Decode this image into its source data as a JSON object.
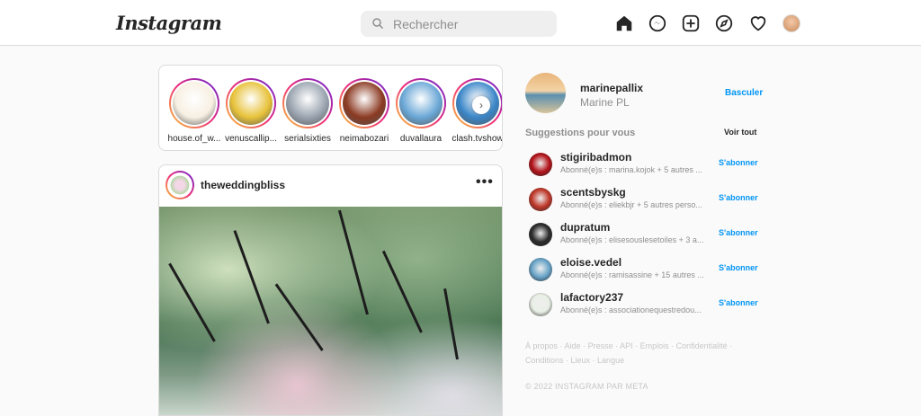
{
  "header": {
    "logo": "Instagram",
    "search_placeholder": "Rechercher",
    "nav_icons": [
      "home-icon",
      "messenger-icon",
      "new-post-icon",
      "explore-icon",
      "activity-icon",
      "profile-avatar"
    ]
  },
  "stories": [
    {
      "name": "house.of_w...",
      "color": "#f7efe2"
    },
    {
      "name": "venuscallip...",
      "color": "#e7c23a"
    },
    {
      "name": "serialsixties",
      "color": "#9aa4b0"
    },
    {
      "name": "neimabozari",
      "color": "#8b3a22"
    },
    {
      "name": "duvallaura",
      "color": "#6aa7d6"
    },
    {
      "name": "clash.tvshow",
      "color": "#3a86c8"
    }
  ],
  "post": {
    "username": "theweddingbliss",
    "more": "•••"
  },
  "profile": {
    "username": "marinepallix",
    "fullname": "Marine PL",
    "switch_label": "Basculer"
  },
  "suggestions": {
    "title": "Suggestions pour vous",
    "see_all": "Voir tout",
    "follow_label": "S'abonner",
    "items": [
      {
        "username": "stigiribadmon",
        "sub": "Abonné(e)s : marina.kojok + 5 autres ...",
        "color": "#b3141b"
      },
      {
        "username": "scentsbyskg",
        "sub": "Abonné(e)s : eliekbjr + 5 autres perso...",
        "color": "#c0392b"
      },
      {
        "username": "dupratum",
        "sub": "Abonné(e)s : elisesouslesetoiles + 3 a...",
        "color": "#2c2c2c"
      },
      {
        "username": "eloise.vedel",
        "sub": "Abonné(e)s : ramisassine + 15 autres ...",
        "color": "#6aa5c9"
      },
      {
        "username": "lafactory237",
        "sub": "Abonné(e)s : associationequestredou...",
        "color": "#e9f0e6"
      }
    ]
  },
  "footer": {
    "links": [
      "À propos",
      "Aide",
      "Presse",
      "API",
      "Emplois",
      "Confidentialité",
      "Conditions",
      "Lieux",
      "Langue"
    ],
    "copyright": "© 2022 INSTAGRAM PAR META"
  }
}
